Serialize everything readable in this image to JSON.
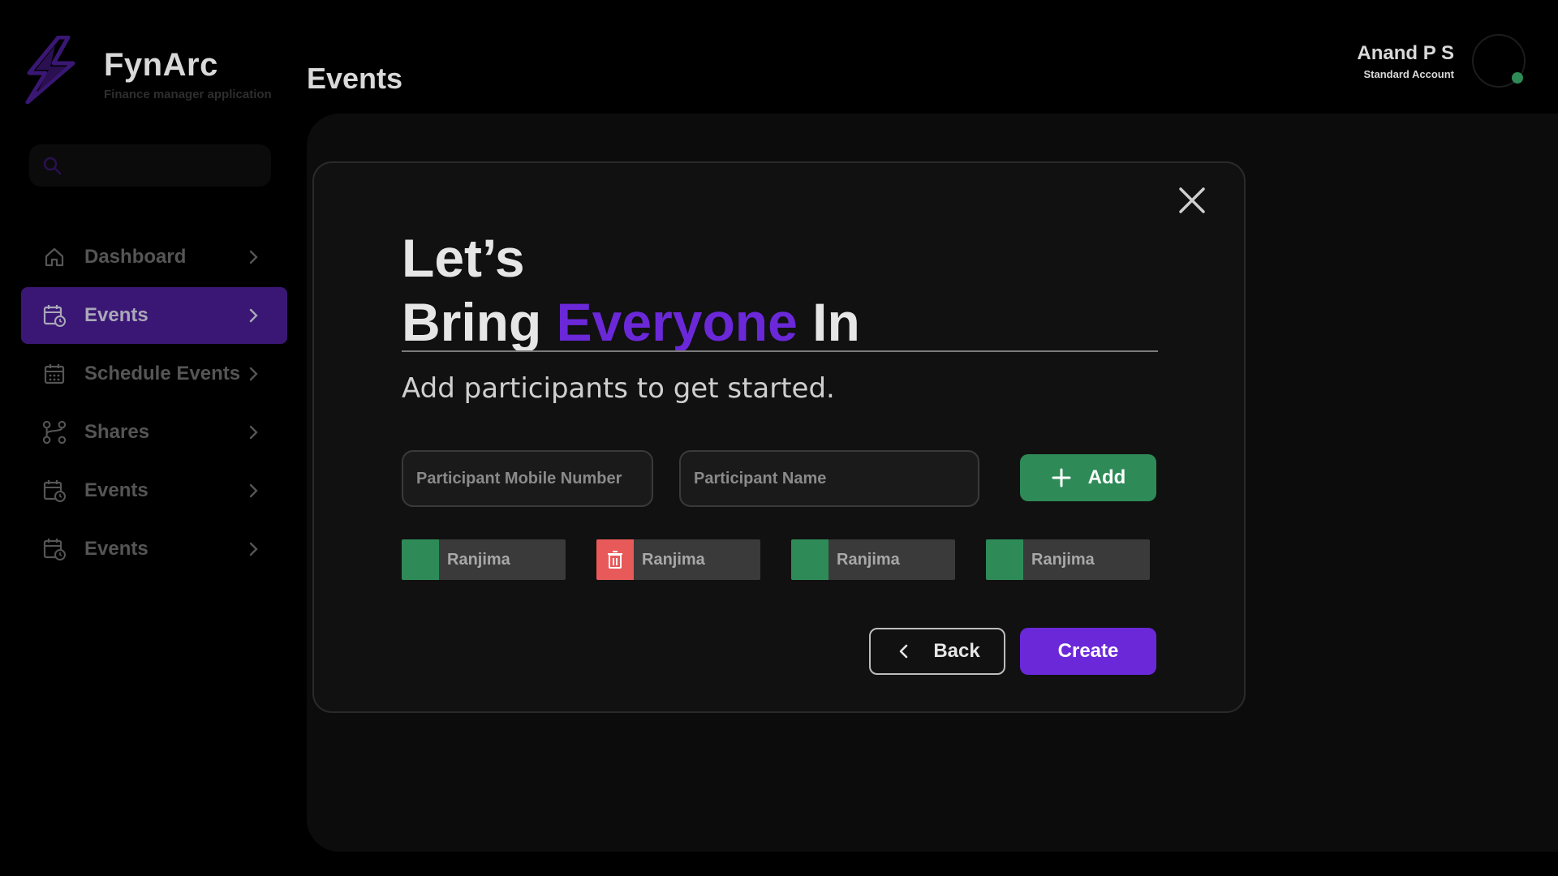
{
  "brand": {
    "name": "FynArc",
    "tagline": "Finance manager application",
    "logo_icon": "lightning-bolt-icon",
    "logo_color": "#3a1774"
  },
  "header": {
    "page_title": "Events"
  },
  "user": {
    "name": "Anand P S",
    "role": "Standard Account",
    "status_color": "#2e8b57"
  },
  "search": {
    "icon": "search-icon",
    "placeholder": ""
  },
  "sidebar": {
    "items": [
      {
        "label": "Dashboard",
        "icon": "home-icon",
        "active": false
      },
      {
        "label": "Events",
        "icon": "calendar-clock-icon",
        "active": true
      },
      {
        "label": "Schedule Events",
        "icon": "calendar-grid-icon",
        "active": false
      },
      {
        "label": "Shares",
        "icon": "share-nodes-icon",
        "active": false
      },
      {
        "label": "Events",
        "icon": "calendar-clock-icon",
        "active": false
      },
      {
        "label": "Events",
        "icon": "calendar-clock-icon",
        "active": false
      }
    ]
  },
  "modal": {
    "heading_line1": "Let’s",
    "heading_line2_prefix": "Bring ",
    "heading_line2_accent": "Everyone",
    "heading_line2_suffix": " In",
    "subtitle": "Add participants to get started.",
    "mobile_placeholder": "Participant Mobile Number",
    "name_placeholder": "Participant Name",
    "add_label": "Add",
    "participants": [
      {
        "name": "Ranjima",
        "state": "added"
      },
      {
        "name": "Ranjima",
        "state": "delete"
      },
      {
        "name": "Ranjima",
        "state": "added"
      },
      {
        "name": "Ranjima",
        "state": "added"
      }
    ],
    "back_label": "Back",
    "create_label": "Create"
  },
  "colors": {
    "accent_purple": "#6b28d9",
    "active_nav": "#3a1774",
    "success_green": "#2e8b57",
    "danger_red": "#e85a5a"
  }
}
